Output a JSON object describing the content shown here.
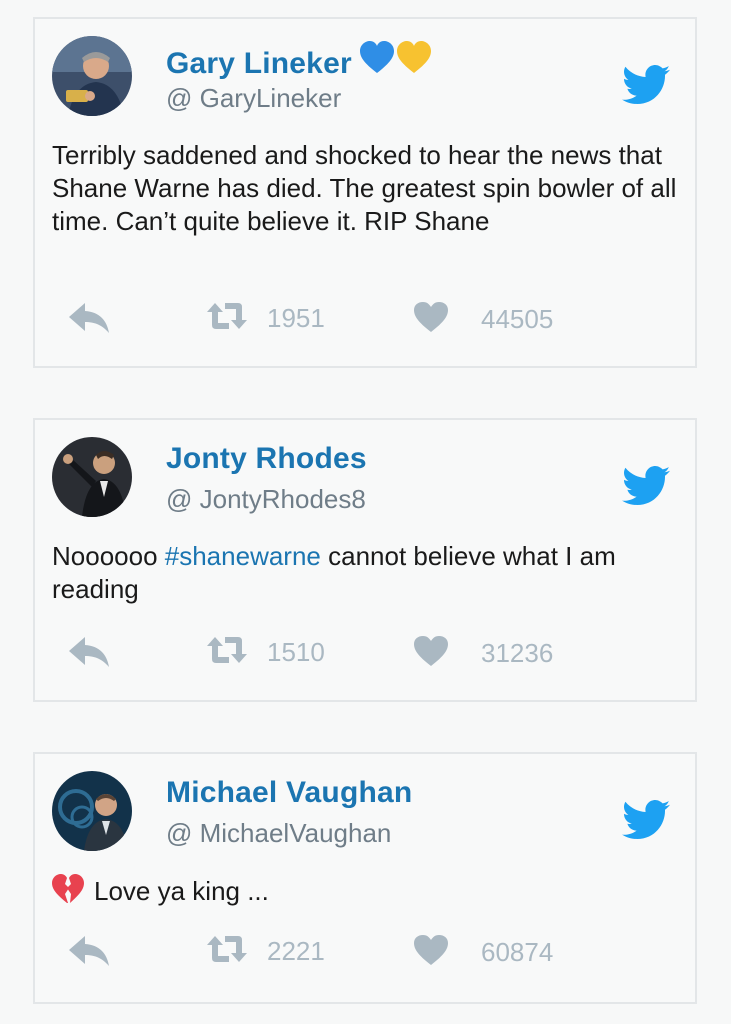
{
  "tweets": [
    {
      "name": "Gary Lineker",
      "name_emoji": "💙💛",
      "handle": "@ GaryLineker",
      "text": "Terribly saddened and shocked to hear the news that Shane Warne has died. The greatest spin bowler of all time.  Can’t quite believe it. RIP Shane",
      "retweets": "1951",
      "likes": "44505"
    },
    {
      "name": "Jonty Rhodes",
      "handle": "@ JontyRhodes8",
      "text_prefix": "Noooooo ",
      "hashtag": "#shanewarne",
      "text_suffix": " cannot believe what I am reading",
      "retweets": "1510",
      "likes": "31236"
    },
    {
      "name": "Michael Vaughan",
      "handle": "@ MichaelVaughan",
      "text_emoji": "💔",
      "text": "Love ya king ...",
      "retweets": "2221",
      "likes": "60874"
    }
  ],
  "icons": {
    "brand": "twitter-bird-icon",
    "reply": "reply-arrow-icon",
    "retweet": "retweet-icon",
    "like": "heart-icon"
  },
  "colors": {
    "name": "#1b75b1",
    "twitter_blue": "#1da1f2",
    "action_gray": "#aab8c2",
    "handle_gray": "#6f7d88"
  }
}
